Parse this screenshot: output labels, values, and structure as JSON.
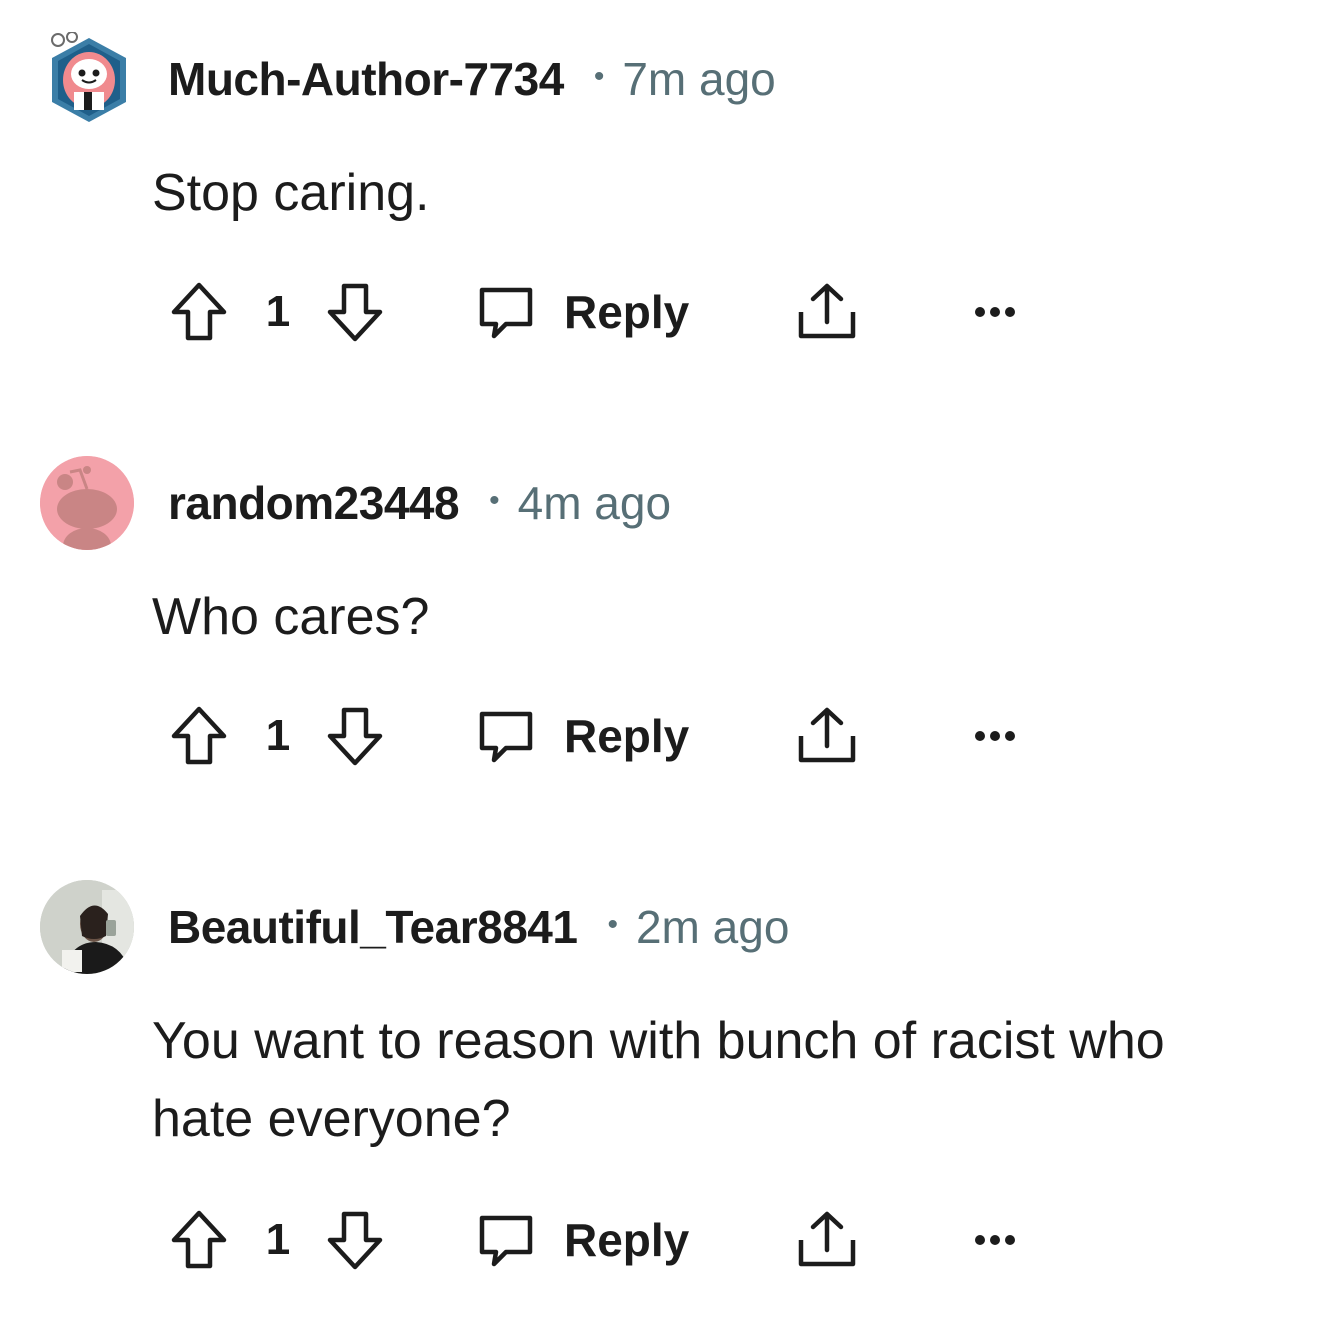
{
  "comments": [
    {
      "author": "Much-Author-7734",
      "separator": "•",
      "time": "7m ago",
      "body": "Stop caring.",
      "score": "1",
      "reply_label": "Reply",
      "avatar": "snoo-avatar-pink-hood"
    },
    {
      "author": "random23448",
      "separator": "•",
      "time": "4m ago",
      "body": "Who cares?",
      "score": "1",
      "reply_label": "Reply",
      "avatar": "default-snoo-avatar-pink"
    },
    {
      "author": "Beautiful_Tear8841",
      "separator": "•",
      "time": "2m ago",
      "body": "You want to reason with bunch of racist who hate everyone?",
      "score": "1",
      "reply_label": "Reply",
      "avatar": "photo-avatar"
    }
  ],
  "colors": {
    "text": "#1c1c1c",
    "meta": "#576f76",
    "avatar_pink": "#f3a1a9"
  }
}
